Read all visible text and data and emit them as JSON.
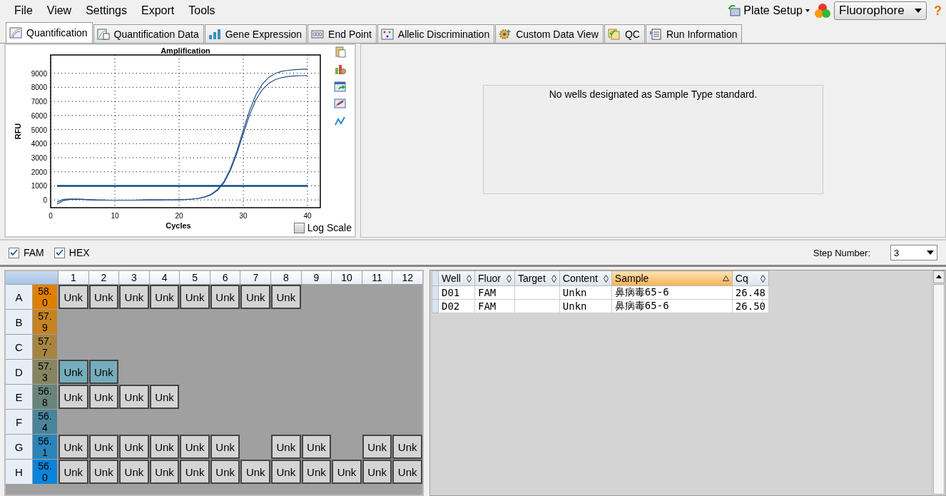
{
  "menu": [
    "File",
    "View",
    "Settings",
    "Export",
    "Tools"
  ],
  "toolbar": {
    "plate_setup": "Plate Setup",
    "fluorophore": "Fluorophore",
    "help": "?"
  },
  "tabs": [
    {
      "label": "Quantification",
      "selected": true
    },
    {
      "label": "Quantification Data",
      "selected": false
    },
    {
      "label": "Gene Expression",
      "selected": false
    },
    {
      "label": "End Point",
      "selected": false
    },
    {
      "label": "Allelic Discrimination",
      "selected": false
    },
    {
      "label": "Custom Data View",
      "selected": false
    },
    {
      "label": "QC",
      "selected": false
    },
    {
      "label": "Run Information",
      "selected": false
    }
  ],
  "amplification": {
    "chart_data": {
      "type": "line",
      "title": "Amplification",
      "xlabel": "Cycles",
      "ylabel": "RFU",
      "xlim": [
        0,
        42
      ],
      "ylim": [
        -550,
        10300
      ],
      "xticks": [
        0,
        10,
        20,
        30,
        40
      ],
      "yticks": [
        0,
        1000,
        2000,
        3000,
        4000,
        5000,
        6000,
        7000,
        8000,
        9000
      ],
      "grid": true,
      "x": [
        1,
        2,
        3,
        4,
        5,
        6,
        7,
        8,
        9,
        10,
        11,
        12,
        13,
        14,
        15,
        16,
        17,
        18,
        19,
        20,
        21,
        22,
        23,
        24,
        25,
        26,
        27,
        28,
        29,
        30,
        31,
        32,
        33,
        34,
        35,
        36,
        37,
        38,
        39,
        40
      ],
      "series": [
        {
          "color": "#1f4e8c",
          "values": [
            -150,
            40,
            70,
            60,
            40,
            20,
            0,
            -10,
            -20,
            -20,
            -20,
            -20,
            -20,
            -10,
            0,
            0,
            0,
            10,
            10,
            20,
            30,
            60,
            110,
            220,
            400,
            740,
            1310,
            2220,
            3470,
            4950,
            6370,
            7500,
            8250,
            8720,
            8990,
            9140,
            9210,
            9250,
            9280,
            9290
          ]
        },
        {
          "color": "#1f4e8c",
          "values": [
            -300,
            -50,
            40,
            50,
            40,
            20,
            0,
            -10,
            -20,
            -20,
            -20,
            -20,
            -20,
            -10,
            0,
            0,
            0,
            10,
            10,
            20,
            30,
            60,
            110,
            200,
            370,
            690,
            1230,
            2100,
            3300,
            4700,
            6060,
            7140,
            7850,
            8300,
            8550,
            8690,
            8770,
            8810,
            8830,
            8840
          ]
        }
      ],
      "ref_lines": [
        {
          "axis": "y",
          "value": 1000,
          "color": "#0b4a8c"
        }
      ]
    },
    "log_scale": {
      "label": "Log Scale",
      "checked": false
    }
  },
  "standard_curve": {
    "message": "No wells designated as Sample Type standard."
  },
  "fluorophores": [
    {
      "label": "FAM",
      "checked": true
    },
    {
      "label": "HEX",
      "checked": true
    }
  ],
  "step": {
    "label": "Step Number:",
    "value": "3"
  },
  "plate": {
    "columns": [
      "1",
      "2",
      "3",
      "4",
      "5",
      "6",
      "7",
      "8",
      "9",
      "10",
      "11",
      "12"
    ],
    "rows": [
      {
        "label": "A",
        "temperature": "58.0",
        "color": "#e08000",
        "wells": [
          {
            "kind": "sample",
            "label": "Unk",
            "selected": false
          },
          {
            "kind": "sample",
            "label": "Unk",
            "selected": false
          },
          {
            "kind": "sample",
            "label": "Unk",
            "selected": false
          },
          {
            "kind": "sample",
            "label": "Unk",
            "selected": false
          },
          {
            "kind": "sample",
            "label": "Unk",
            "selected": false
          },
          {
            "kind": "sample",
            "label": "Unk",
            "selected": false
          },
          {
            "kind": "sample",
            "label": "Unk",
            "selected": false
          },
          {
            "kind": "sample",
            "label": "Unk",
            "selected": false
          },
          {
            "kind": "empty"
          },
          {
            "kind": "empty"
          },
          {
            "kind": "empty"
          },
          {
            "kind": "empty"
          }
        ]
      },
      {
        "label": "B",
        "temperature": "57.9",
        "color": "#c58322",
        "wells": [
          {
            "kind": "empty"
          },
          {
            "kind": "empty"
          },
          {
            "kind": "empty"
          },
          {
            "kind": "empty"
          },
          {
            "kind": "empty"
          },
          {
            "kind": "empty"
          },
          {
            "kind": "empty"
          },
          {
            "kind": "empty"
          },
          {
            "kind": "empty"
          },
          {
            "kind": "empty"
          },
          {
            "kind": "empty"
          },
          {
            "kind": "empty"
          }
        ]
      },
      {
        "label": "C",
        "temperature": "57.7",
        "color": "#a68442",
        "wells": [
          {
            "kind": "empty"
          },
          {
            "kind": "empty"
          },
          {
            "kind": "empty"
          },
          {
            "kind": "empty"
          },
          {
            "kind": "empty"
          },
          {
            "kind": "empty"
          },
          {
            "kind": "empty"
          },
          {
            "kind": "empty"
          },
          {
            "kind": "empty"
          },
          {
            "kind": "empty"
          },
          {
            "kind": "empty"
          },
          {
            "kind": "empty"
          }
        ]
      },
      {
        "label": "D",
        "temperature": "57.3",
        "color": "#878462",
        "wells": [
          {
            "kind": "sample",
            "label": "Unk",
            "selected": true
          },
          {
            "kind": "sample",
            "label": "Unk",
            "selected": true
          },
          {
            "kind": "empty"
          },
          {
            "kind": "empty"
          },
          {
            "kind": "empty"
          },
          {
            "kind": "empty"
          },
          {
            "kind": "empty"
          },
          {
            "kind": "empty"
          },
          {
            "kind": "empty"
          },
          {
            "kind": "empty"
          },
          {
            "kind": "empty"
          },
          {
            "kind": "empty"
          }
        ]
      },
      {
        "label": "E",
        "temperature": "56.8",
        "color": "#69847c",
        "wells": [
          {
            "kind": "sample",
            "label": "Unk",
            "selected": false
          },
          {
            "kind": "sample",
            "label": "Unk",
            "selected": false
          },
          {
            "kind": "sample",
            "label": "Unk",
            "selected": false
          },
          {
            "kind": "sample",
            "label": "Unk",
            "selected": false
          },
          {
            "kind": "empty"
          },
          {
            "kind": "empty"
          },
          {
            "kind": "empty"
          },
          {
            "kind": "empty"
          },
          {
            "kind": "empty"
          },
          {
            "kind": "empty"
          },
          {
            "kind": "empty"
          },
          {
            "kind": "empty"
          }
        ]
      },
      {
        "label": "F",
        "temperature": "56.4",
        "color": "#4a849a",
        "wells": [
          {
            "kind": "empty"
          },
          {
            "kind": "empty"
          },
          {
            "kind": "empty"
          },
          {
            "kind": "empty"
          },
          {
            "kind": "empty"
          },
          {
            "kind": "empty"
          },
          {
            "kind": "empty"
          },
          {
            "kind": "empty"
          },
          {
            "kind": "empty"
          },
          {
            "kind": "empty"
          },
          {
            "kind": "empty"
          },
          {
            "kind": "empty"
          }
        ]
      },
      {
        "label": "G",
        "temperature": "56.1",
        "color": "#2a84ba",
        "wells": [
          {
            "kind": "sample",
            "label": "Unk",
            "selected": false
          },
          {
            "kind": "sample",
            "label": "Unk",
            "selected": false
          },
          {
            "kind": "sample",
            "label": "Unk",
            "selected": false
          },
          {
            "kind": "sample",
            "label": "Unk",
            "selected": false
          },
          {
            "kind": "sample",
            "label": "Unk",
            "selected": false
          },
          {
            "kind": "sample",
            "label": "Unk",
            "selected": false
          },
          {
            "kind": "empty"
          },
          {
            "kind": "sample",
            "label": "Unk",
            "selected": false
          },
          {
            "kind": "sample",
            "label": "Unk",
            "selected": false
          },
          {
            "kind": "empty"
          },
          {
            "kind": "sample",
            "label": "Unk",
            "selected": false
          },
          {
            "kind": "sample",
            "label": "Unk",
            "selected": false
          }
        ]
      },
      {
        "label": "H",
        "temperature": "56.0",
        "color": "#0a84da",
        "wells": [
          {
            "kind": "sample",
            "label": "Unk",
            "selected": false
          },
          {
            "kind": "sample",
            "label": "Unk",
            "selected": false
          },
          {
            "kind": "sample",
            "label": "Unk",
            "selected": false
          },
          {
            "kind": "sample",
            "label": "Unk",
            "selected": false
          },
          {
            "kind": "sample",
            "label": "Unk",
            "selected": false
          },
          {
            "kind": "sample",
            "label": "Unk",
            "selected": false
          },
          {
            "kind": "sample",
            "label": "Unk",
            "selected": false
          },
          {
            "kind": "sample",
            "label": "Unk",
            "selected": false
          },
          {
            "kind": "sample",
            "label": "Unk",
            "selected": false
          },
          {
            "kind": "sample",
            "label": "Unk",
            "selected": false
          },
          {
            "kind": "sample",
            "label": "Unk",
            "selected": false
          },
          {
            "kind": "sample",
            "label": "Unk",
            "selected": false
          }
        ]
      }
    ]
  },
  "table": {
    "columns": [
      {
        "label": "Well",
        "sorted": false
      },
      {
        "label": "Fluor",
        "sorted": false
      },
      {
        "label": "Target",
        "sorted": false
      },
      {
        "label": "Content",
        "sorted": false
      },
      {
        "label": "Sample",
        "sorted": true
      },
      {
        "label": "Cq",
        "sorted": false
      }
    ],
    "rows": [
      {
        "well": "D01",
        "fluor": "FAM",
        "content": "Unkn",
        "sample": "鼻病毒65-6",
        "cq": "26.48"
      },
      {
        "well": "D02",
        "fluor": "FAM",
        "content": "Unkn",
        "sample": "鼻病毒65-6",
        "cq": "26.50"
      }
    ]
  }
}
